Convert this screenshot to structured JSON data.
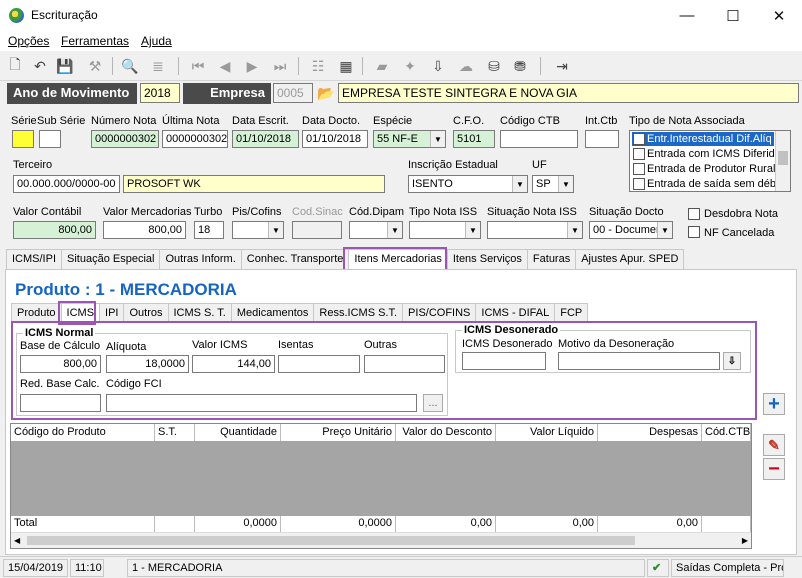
{
  "window": {
    "title": "Escrituração",
    "minimize": "—",
    "maximize": "☐",
    "close": "✕"
  },
  "menu": [
    "Opções",
    "Ferramentas",
    "Ajuda"
  ],
  "topbar": {
    "ano_label": "Ano de Movimento",
    "ano_value": "2018",
    "empresa_label": "Empresa",
    "empresa_code": "0005",
    "empresa_name": "EMPRESA TESTE SINTEGRA E NOVA GIA"
  },
  "header": {
    "serie_label": "Série",
    "subserie_label": "Sub Série",
    "numero_label": "Número Nota",
    "numero_value": "0000000302",
    "ultima_label": "Última Nota",
    "ultima_value": "0000000302",
    "data_escrit_label": "Data Escrit.",
    "data_escrit_value": "01/10/2018",
    "data_docto_label": "Data Docto.",
    "data_docto_value": "01/10/2018",
    "especie_label": "Espécie",
    "especie_value": "55  NF-E",
    "cfo_label": "C.F.O.",
    "cfo_value": "5101",
    "codigo_ctb_label": "Código CTB",
    "intctb_label": "Int.Ctb",
    "tipo_nota_label": "Tipo de Nota Associada",
    "tipo_nota_items": [
      "Entr.Interestadual Dif.Alíq",
      "Entrada com ICMS Diferido",
      "Entrada de Produtor Rural",
      "Entrada de saída sem débi"
    ],
    "terceiro_label": "Terceiro",
    "terceiro_cnpj": "00.000.000/0000-00",
    "terceiro_name": "PROSOFT WK",
    "ie_label": "Inscrição Estadual",
    "ie_value": "ISENTO",
    "uf_label": "UF",
    "uf_value": "SP",
    "valor_contabil_label": "Valor Contábil",
    "valor_contabil_value": "800,00",
    "valor_merc_label": "Valor Mercadorias",
    "valor_merc_value": "800,00",
    "turbo_label": "Turbo",
    "turbo_value": "18",
    "piscofins_label": "Pis/Cofins",
    "codsinac_label": "Cod.Sinac",
    "coddipam_label": "Cód.Dipam",
    "tiponotaiss_label": "Tipo Nota ISS",
    "situacaoiss_label": "Situação Nota ISS",
    "situacaodocto_label": "Situação Docto",
    "situacaodocto_value": "00 - Documen",
    "desdobra_label": "Desdobra Nota",
    "nfcancelada_label": "NF Cancelada"
  },
  "main_tabs": [
    "ICMS/IPI",
    "Situação Especial",
    "Outras Inform.",
    "Conhec. Transporte",
    "Itens Mercadorias",
    "Itens Serviços",
    "Faturas",
    "Ajustes Apur. SPED"
  ],
  "produto_title": "Produto : 1 - MERCADORIA",
  "sub_tabs": [
    "Produto",
    "ICMS",
    "IPI",
    "Outros",
    "ICMS S. T.",
    "Medicamentos",
    "Ress.ICMS S.T.",
    "PIS/COFINS",
    "ICMS - DIFAL",
    "FCP"
  ],
  "icms_normal": {
    "title": "ICMS Normal",
    "base_label": "Base de Cálculo",
    "base_value": "800,00",
    "aliquota_label": "Alíquota",
    "aliquota_value": "18,0000",
    "valor_label": "Valor ICMS",
    "valor_value": "144,00",
    "isentas_label": "Isentas",
    "outras_label": "Outras",
    "redbase_label": "Red. Base Calc.",
    "codfci_label": "Código FCI",
    "ellipsis": "..."
  },
  "icms_desonerado": {
    "title": "ICMS Desonerado",
    "valor_label": "ICMS Desonerado",
    "motivo_label": "Motivo da Desoneração"
  },
  "grid": {
    "columns": [
      "Código do Produto",
      "S.T.",
      "Quantidade",
      "Preço Unitário",
      "Valor do Desconto",
      "Valor Líquido",
      "Despesas",
      "Cód.CTB"
    ],
    "total_label": "Total",
    "totals": [
      "0,0000",
      "0,0000",
      "0,00",
      "0,00",
      "0,00"
    ]
  },
  "side_buttons": {
    "add": "+",
    "edit": "✎",
    "remove": "−"
  },
  "status": {
    "date": "15/04/2019",
    "time": "11:10",
    "product": "1 - MERCADORIA",
    "mode": "Saídas Completa - Pros"
  },
  "colors": {
    "highlight": "#9b55b3",
    "title_blue": "#1565c0",
    "dark_label": "#4a4a4a"
  }
}
